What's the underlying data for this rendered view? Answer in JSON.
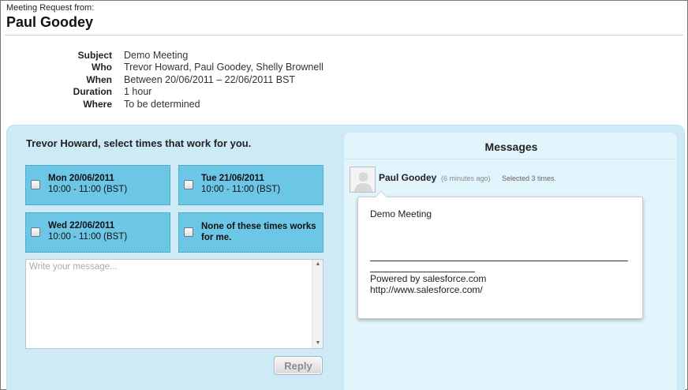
{
  "header": {
    "label": "Meeting Request from:",
    "organizer": "Paul Goodey"
  },
  "details": [
    {
      "label": "Subject",
      "value": "Demo Meeting"
    },
    {
      "label": "Who",
      "value": "Trevor Howard, Paul Goodey, Shelly Brownell"
    },
    {
      "label": "When",
      "value": "Between 20/06/2011 – 22/06/2011 BST"
    },
    {
      "label": "Duration",
      "value": "1 hour"
    },
    {
      "label": "Where",
      "value": "To be determined"
    }
  ],
  "selection": {
    "title": "Trevor Howard, select times that work for you.",
    "slots": [
      {
        "day": "Mon 20/06/2011",
        "time": "10:00 - 11:00 (BST)"
      },
      {
        "day": "Tue 21/06/2011",
        "time": "10:00 - 11:00 (BST)"
      },
      {
        "day": "Wed 22/06/2011",
        "time": "10:00 - 11:00 (BST)"
      },
      {
        "day": "None of these times works for me.",
        "time": ""
      }
    ],
    "message_placeholder": "Write your message...",
    "reply_label": "Reply"
  },
  "messages": {
    "title": "Messages",
    "items": [
      {
        "author": "Paul Goodey",
        "time": "(6 minutes ago)",
        "status": "Selected 3 times.",
        "body_subject": "Demo Meeting",
        "powered_by": "Powered by salesforce.com",
        "url": "http://www.salesforce.com/"
      }
    ]
  },
  "icons": {
    "avatar": "user-silhouette-icon",
    "scroll_up": "scroll-up-arrow-icon",
    "scroll_down": "scroll-down-arrow-icon"
  },
  "colors": {
    "panel_bg": "#cfeaf7",
    "slot_bg": "#6cc6e6",
    "messages_bg": "#e2f4fc"
  }
}
